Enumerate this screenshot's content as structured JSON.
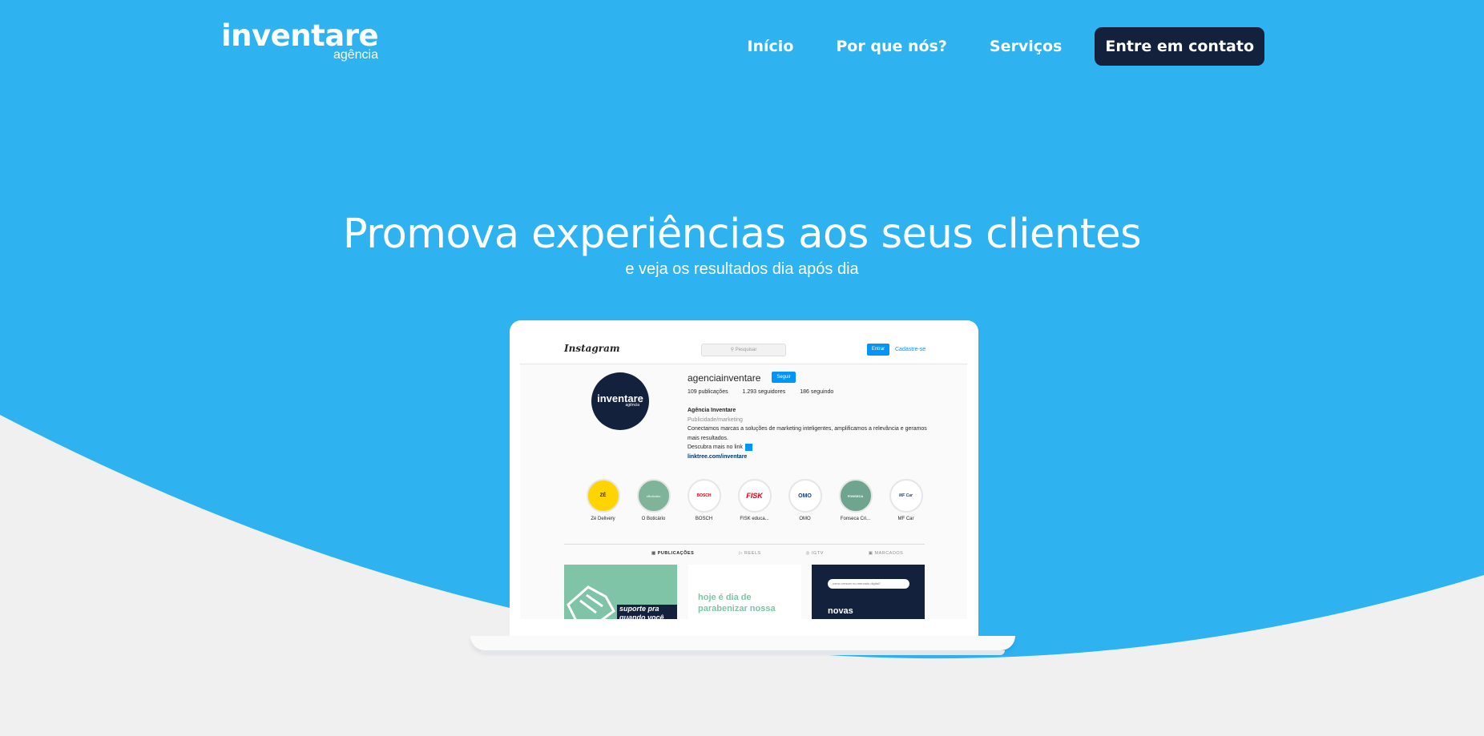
{
  "brand": {
    "name": "inventare",
    "sub": "agência"
  },
  "nav": {
    "items": [
      "Início",
      "Por que nós?",
      "Serviços"
    ],
    "cta": "Entre em contato"
  },
  "hero": {
    "title": "Promova experiências aos seus clientes",
    "subtitle": "e veja os resultados dia após dia"
  },
  "instagram": {
    "logo": "Instagram",
    "search_placeholder": "Pesquisar",
    "login_label": "Entrar",
    "signup_label": "Cadastre-se",
    "username": "agenciainventare",
    "follow_label": "Seguir",
    "avatar_word": "inventare",
    "avatar_sub": "agência",
    "stats": {
      "posts": "109 publicações",
      "followers": "1.293 seguidores",
      "following": "186 seguindo"
    },
    "bio": {
      "name": "Agência Inventare",
      "category": "Publicidade/marketing",
      "text": "Conectamos marcas a soluções de marketing inteligentes, amplificamos a relevância e geramos mais resultados.",
      "cta": "Descubra mais no link",
      "link": "linktree.com/inventare"
    },
    "highlights": [
      {
        "label": "Zé Delivery",
        "mark": "ZÉ"
      },
      {
        "label": "O Boticário",
        "mark": "oBoticário"
      },
      {
        "label": "BOSCH",
        "mark": "BOSCH"
      },
      {
        "label": "FISK educa...",
        "mark": "FISK"
      },
      {
        "label": "OMO",
        "mark": "OMO"
      },
      {
        "label": "Fonseca Cri...",
        "mark": "FONSECA"
      },
      {
        "label": "MF Car",
        "mark": "MF Car"
      }
    ],
    "tabs": [
      "PUBLICAÇÕES",
      "REELS",
      "IGTV",
      "MARCADOS"
    ],
    "posts": {
      "post1_text": "suporte pra quando você",
      "post2_text": "hoje é dia de parabenizar nossa",
      "post3_search": "como crescer no mercado digital?",
      "post3_text": "novas"
    }
  },
  "colors": {
    "hero_blue": "#2eb2f0",
    "navy": "#13213c",
    "page_bg": "#f0f0f0",
    "ig_blue": "#0095f6"
  }
}
